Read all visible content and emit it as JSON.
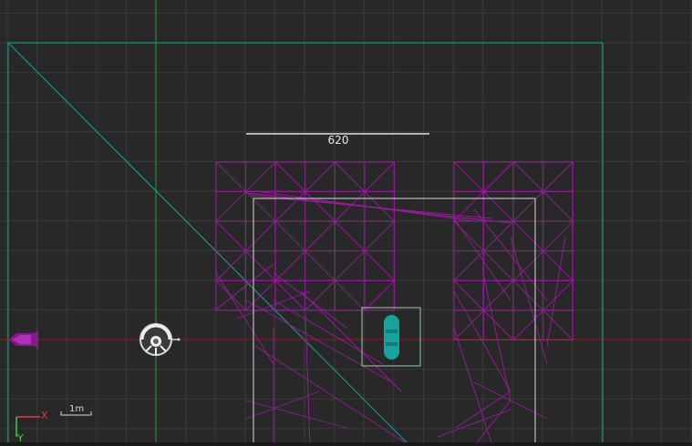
{
  "viewport": {
    "dimension_label": "620",
    "scale_bar_label": "1m",
    "axis_x_label": "X",
    "axis_y_label": "Y"
  },
  "colors": {
    "background": "#282828",
    "grid": "#3a3a3a",
    "mesh": "#9a1aa0",
    "boundary": "#1f8f8a",
    "x_axis": "#a01818",
    "y_axis": "#2aa02a",
    "robot": "#17a3a0",
    "wall": "#c8c8c8"
  },
  "icons": {
    "camera_sensor": "camera-sensor-icon",
    "robot_marker": "robot-marker-icon",
    "goal_arrow": "goal-arrow-icon"
  }
}
